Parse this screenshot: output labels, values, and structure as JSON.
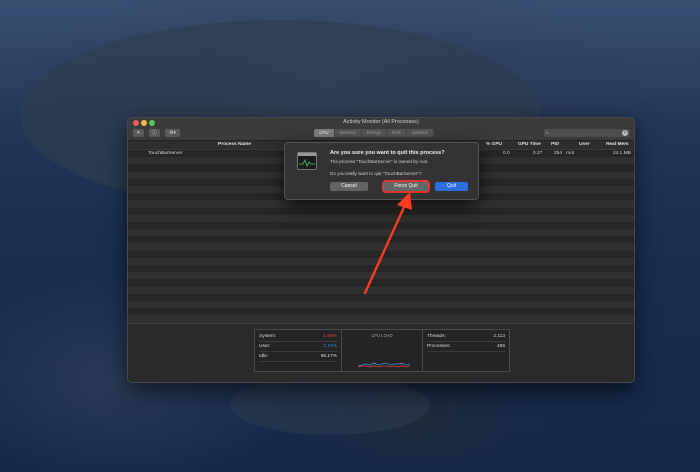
{
  "window": {
    "title": "Activity Monitor (All Processes)",
    "toolbar": {
      "tabs": [
        {
          "label": "CPU",
          "active": true
        },
        {
          "label": "Memory",
          "active": false
        },
        {
          "label": "Energy",
          "active": false
        },
        {
          "label": "Disk",
          "active": false
        },
        {
          "label": "Network",
          "active": false
        }
      ],
      "search_placeholder": ""
    },
    "columns": {
      "process_name": "Process Name",
      "pct_gpu": "% GPU",
      "gpu_time": "GPU Time",
      "pid": "PID",
      "user": "User",
      "real_mem": "Real Mem"
    },
    "rows": [
      {
        "process_name": "TouchBarServer",
        "pct_gpu": "0.0",
        "gpu_time": "0.27",
        "pid": "254",
        "user": "root",
        "real_mem": "24.1 MB"
      }
    ],
    "footer": {
      "system_label": "System:",
      "system_value": "1.66%",
      "user_label": "User:",
      "user_value": "2.16%",
      "idle_label": "Idle:",
      "idle_value": "96.17%",
      "cpu_load_label": "CPU LOAD",
      "threads_label": "Threads:",
      "threads_value": "2,113",
      "processes_label": "Processes:",
      "processes_value": "486",
      "system_color": "#e0443a",
      "user_color": "#3d8de0"
    }
  },
  "dialog": {
    "title": "Are you sure you want to quit this process?",
    "message": "The process “TouchBarServer” is owned by root.",
    "question": "Do you really want to quit “TouchBarServer”?",
    "cancel_label": "Cancel",
    "force_quit_label": "Force Quit",
    "quit_label": "Quit",
    "highlight_color": "#e2372c",
    "accent_color": "#2f6ee0"
  },
  "annotation": {
    "arrow_color": "#ff3b22"
  }
}
